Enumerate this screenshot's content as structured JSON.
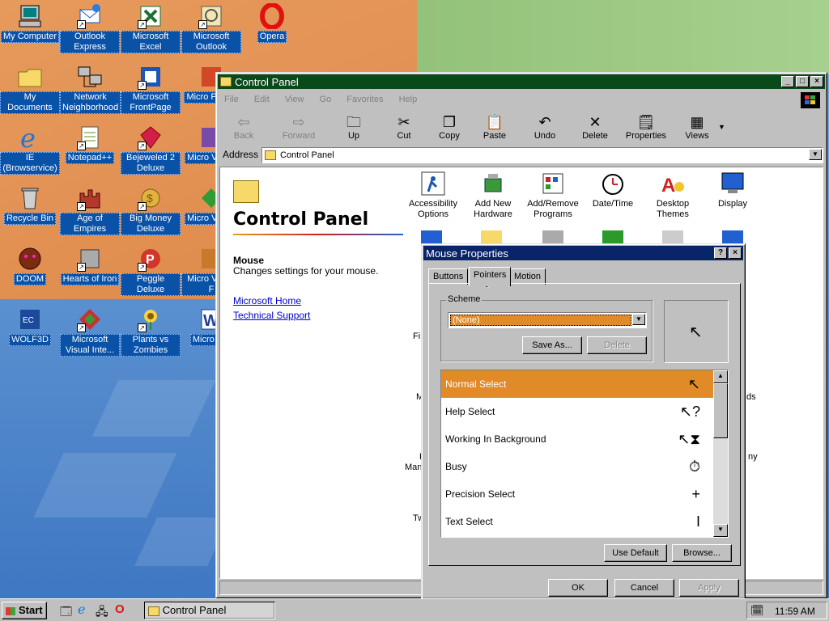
{
  "desktop": {
    "icons": [
      {
        "label": "My Computer"
      },
      {
        "label": "Outlook Express"
      },
      {
        "label": "Microsoft Excel"
      },
      {
        "label": "Microsoft Outlook"
      },
      {
        "label": "Opera"
      },
      {
        "label": "My Documents"
      },
      {
        "label": "Network Neighborhood"
      },
      {
        "label": "Microsoft FrontPage"
      },
      {
        "label": "Micro Power"
      },
      {
        "label": "IE (Browservice)"
      },
      {
        "label": "Notepad++"
      },
      {
        "label": "Bejeweled 2 Deluxe"
      },
      {
        "label": "Micro Visual"
      },
      {
        "label": "Recycle Bin"
      },
      {
        "label": "Age of Empires"
      },
      {
        "label": "Big Money Deluxe"
      },
      {
        "label": "Micro Visual"
      },
      {
        "label": "DOOM"
      },
      {
        "label": "Hearts of Iron"
      },
      {
        "label": "Peggle Deluxe"
      },
      {
        "label": "Micro Visual F"
      },
      {
        "label": "WOLF3D"
      },
      {
        "label": "Microsoft Visual Inte..."
      },
      {
        "label": "Plants vs Zombies"
      },
      {
        "label": "Micro Wo"
      }
    ],
    "colors": {
      "orange": "#e69a5c",
      "blue": "#5d93d1",
      "green": "#9cca84"
    }
  },
  "control_panel": {
    "title": "Control Panel",
    "menu": [
      "File",
      "Edit",
      "View",
      "Go",
      "Favorites",
      "Help"
    ],
    "toolbar": {
      "back": "Back",
      "forward": "Forward",
      "up": "Up",
      "cut": "Cut",
      "copy": "Copy",
      "paste": "Paste",
      "undo": "Undo",
      "delete": "Delete",
      "properties": "Properties",
      "views": "Views"
    },
    "address_label": "Address",
    "address_value": "Control Panel",
    "heading": "Control Panel",
    "selected_name": "Mouse",
    "selected_desc": "Changes settings for your mouse.",
    "links": [
      "Microsoft Home",
      "Technical Support"
    ],
    "items": [
      {
        "label": "Accessibility Options"
      },
      {
        "label": "Add New Hardware"
      },
      {
        "label": "Add/Remove Programs"
      },
      {
        "label": "Date/Time"
      },
      {
        "label": "Desktop Themes"
      },
      {
        "label": "Display"
      }
    ],
    "partial_labels": [
      "Fi",
      "M",
      "P",
      "Man",
      "Tw",
      "ds",
      "ny"
    ]
  },
  "mouse_props": {
    "title": "Mouse Properties",
    "tabs": [
      "Buttons",
      "Pointers",
      "Motion"
    ],
    "active_tab": "Pointers",
    "scheme_label": "Scheme",
    "scheme_value": "(None)",
    "save_as": "Save As...",
    "delete": "Delete",
    "pointers": [
      {
        "name": "Normal Select",
        "icon": "arrow-cursor-icon",
        "glyph": "↖"
      },
      {
        "name": "Help Select",
        "icon": "help-cursor-icon",
        "glyph": "↖?"
      },
      {
        "name": "Working In Background",
        "icon": "working-cursor-icon",
        "glyph": "↖⧗"
      },
      {
        "name": "Busy",
        "icon": "busy-cursor-icon",
        "glyph": "⏱"
      },
      {
        "name": "Precision Select",
        "icon": "crosshair-cursor-icon",
        "glyph": "+"
      },
      {
        "name": "Text Select",
        "icon": "ibeam-cursor-icon",
        "glyph": "I"
      }
    ],
    "selected_pointer_color": "#e08a28",
    "use_default": "Use Default",
    "browse": "Browse...",
    "ok": "OK",
    "cancel": "Cancel",
    "apply": "Apply"
  },
  "taskbar": {
    "start": "Start",
    "task": "Control Panel",
    "clock": "11:59 AM"
  }
}
